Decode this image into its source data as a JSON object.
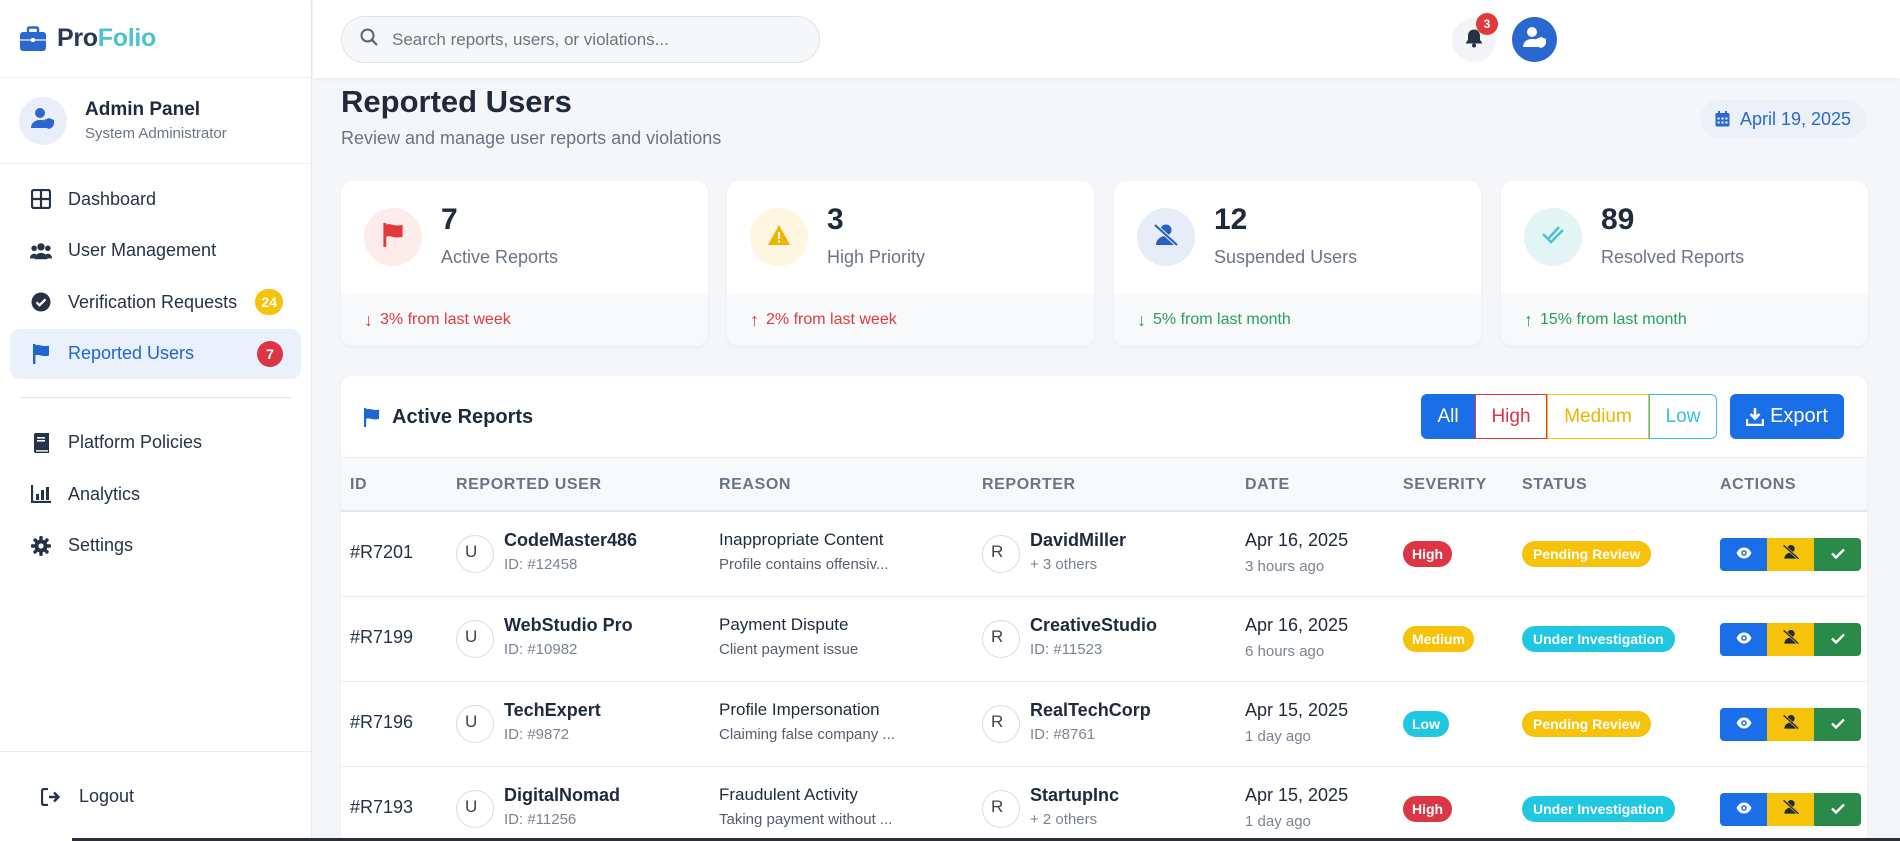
{
  "brand": {
    "name_a": "Pro",
    "name_b": "Folio"
  },
  "profile": {
    "name": "Admin Panel",
    "role": "System Administrator"
  },
  "nav": [
    {
      "label": "Dashboard",
      "icon": "dashboard-grid-icon"
    },
    {
      "label": "User Management",
      "icon": "users-icon"
    },
    {
      "label": "Verification Requests",
      "icon": "check-circle-icon",
      "badge": "24"
    },
    {
      "label": "Reported Users",
      "icon": "flag-icon",
      "badge": "7",
      "active": true
    },
    {
      "label": "Platform Policies",
      "icon": "book-icon"
    },
    {
      "label": "Analytics",
      "icon": "chart-bar-icon"
    },
    {
      "label": "Settings",
      "icon": "gear-icon"
    }
  ],
  "logout_label": "Logout",
  "search": {
    "placeholder": "Search reports, users, or violations..."
  },
  "notifications": {
    "count": "3"
  },
  "page": {
    "title": "Reported Users",
    "subtitle": "Review and manage user reports and violations",
    "date": "April 19, 2025"
  },
  "stats": [
    {
      "value": "7",
      "label": "Active Reports",
      "trend": "3% from last week",
      "direction": "down",
      "trend_color": "#e03a3e",
      "icon": "flag-icon",
      "icon_bg": "#fdecea",
      "icon_color": "#e03a3e"
    },
    {
      "value": "3",
      "label": "High Priority",
      "trend": "2% from last week",
      "direction": "up",
      "trend_color": "#e03a3e",
      "icon": "warning-icon",
      "icon_bg": "#fff6e0",
      "icon_color": "#f0b400"
    },
    {
      "value": "12",
      "label": "Suspended Users",
      "trend": "5% from last month",
      "direction": "down",
      "trend_color": "#2aa05a",
      "icon": "user-slash-icon",
      "icon_bg": "#e6ecf8",
      "icon_color": "#2a5fbf"
    },
    {
      "value": "89",
      "label": "Resolved Reports",
      "trend": "15% from last month",
      "direction": "up",
      "trend_color": "#2aa05a",
      "icon": "double-check-icon",
      "icon_bg": "#e3f4f4",
      "icon_color": "#4ec3c9"
    }
  ],
  "reports_panel": {
    "title": "Active Reports",
    "filters": [
      "All",
      "High",
      "Medium",
      "Low"
    ],
    "export_label": "Export",
    "columns": [
      "ID",
      "REPORTED USER",
      "REASON",
      "REPORTER",
      "DATE",
      "SEVERITY",
      "STATUS",
      "ACTIONS"
    ],
    "rows": [
      {
        "id": "#R7201",
        "user": "CodeMaster486",
        "user_id": "ID: #12458",
        "reason": "Inappropriate Content",
        "reason_detail": "Profile contains offensiv...",
        "reporter": "DavidMiller",
        "reporter_sub": "+ 3 others",
        "date": "Apr 16, 2025",
        "ago": "3 hours ago",
        "severity": "High",
        "status": "Pending Review"
      },
      {
        "id": "#R7199",
        "user": "WebStudio Pro",
        "user_id": "ID: #10982",
        "reason": "Payment Dispute",
        "reason_detail": "Client payment issue",
        "reporter": "CreativeStudio",
        "reporter_sub": "ID: #11523",
        "date": "Apr 16, 2025",
        "ago": "6 hours ago",
        "severity": "Medium",
        "status": "Under Investigation"
      },
      {
        "id": "#R7196",
        "user": "TechExpert",
        "user_id": "ID: #9872",
        "reason": "Profile Impersonation",
        "reason_detail": "Claiming false company ...",
        "reporter": "RealTechCorp",
        "reporter_sub": "ID: #8761",
        "date": "Apr 15, 2025",
        "ago": "1 day ago",
        "severity": "Low",
        "status": "Pending Review"
      },
      {
        "id": "#R7193",
        "user": "DigitalNomad",
        "user_id": "ID: #11256",
        "reason": "Fraudulent Activity",
        "reason_detail": "Taking payment without ...",
        "reporter": "StartupInc",
        "reporter_sub": "+ 2 others",
        "date": "Apr 15, 2025",
        "ago": "1 day ago",
        "severity": "High",
        "status": "Under Investigation"
      }
    ],
    "avatar_alt_user": "U",
    "avatar_alt_reporter": "R"
  }
}
